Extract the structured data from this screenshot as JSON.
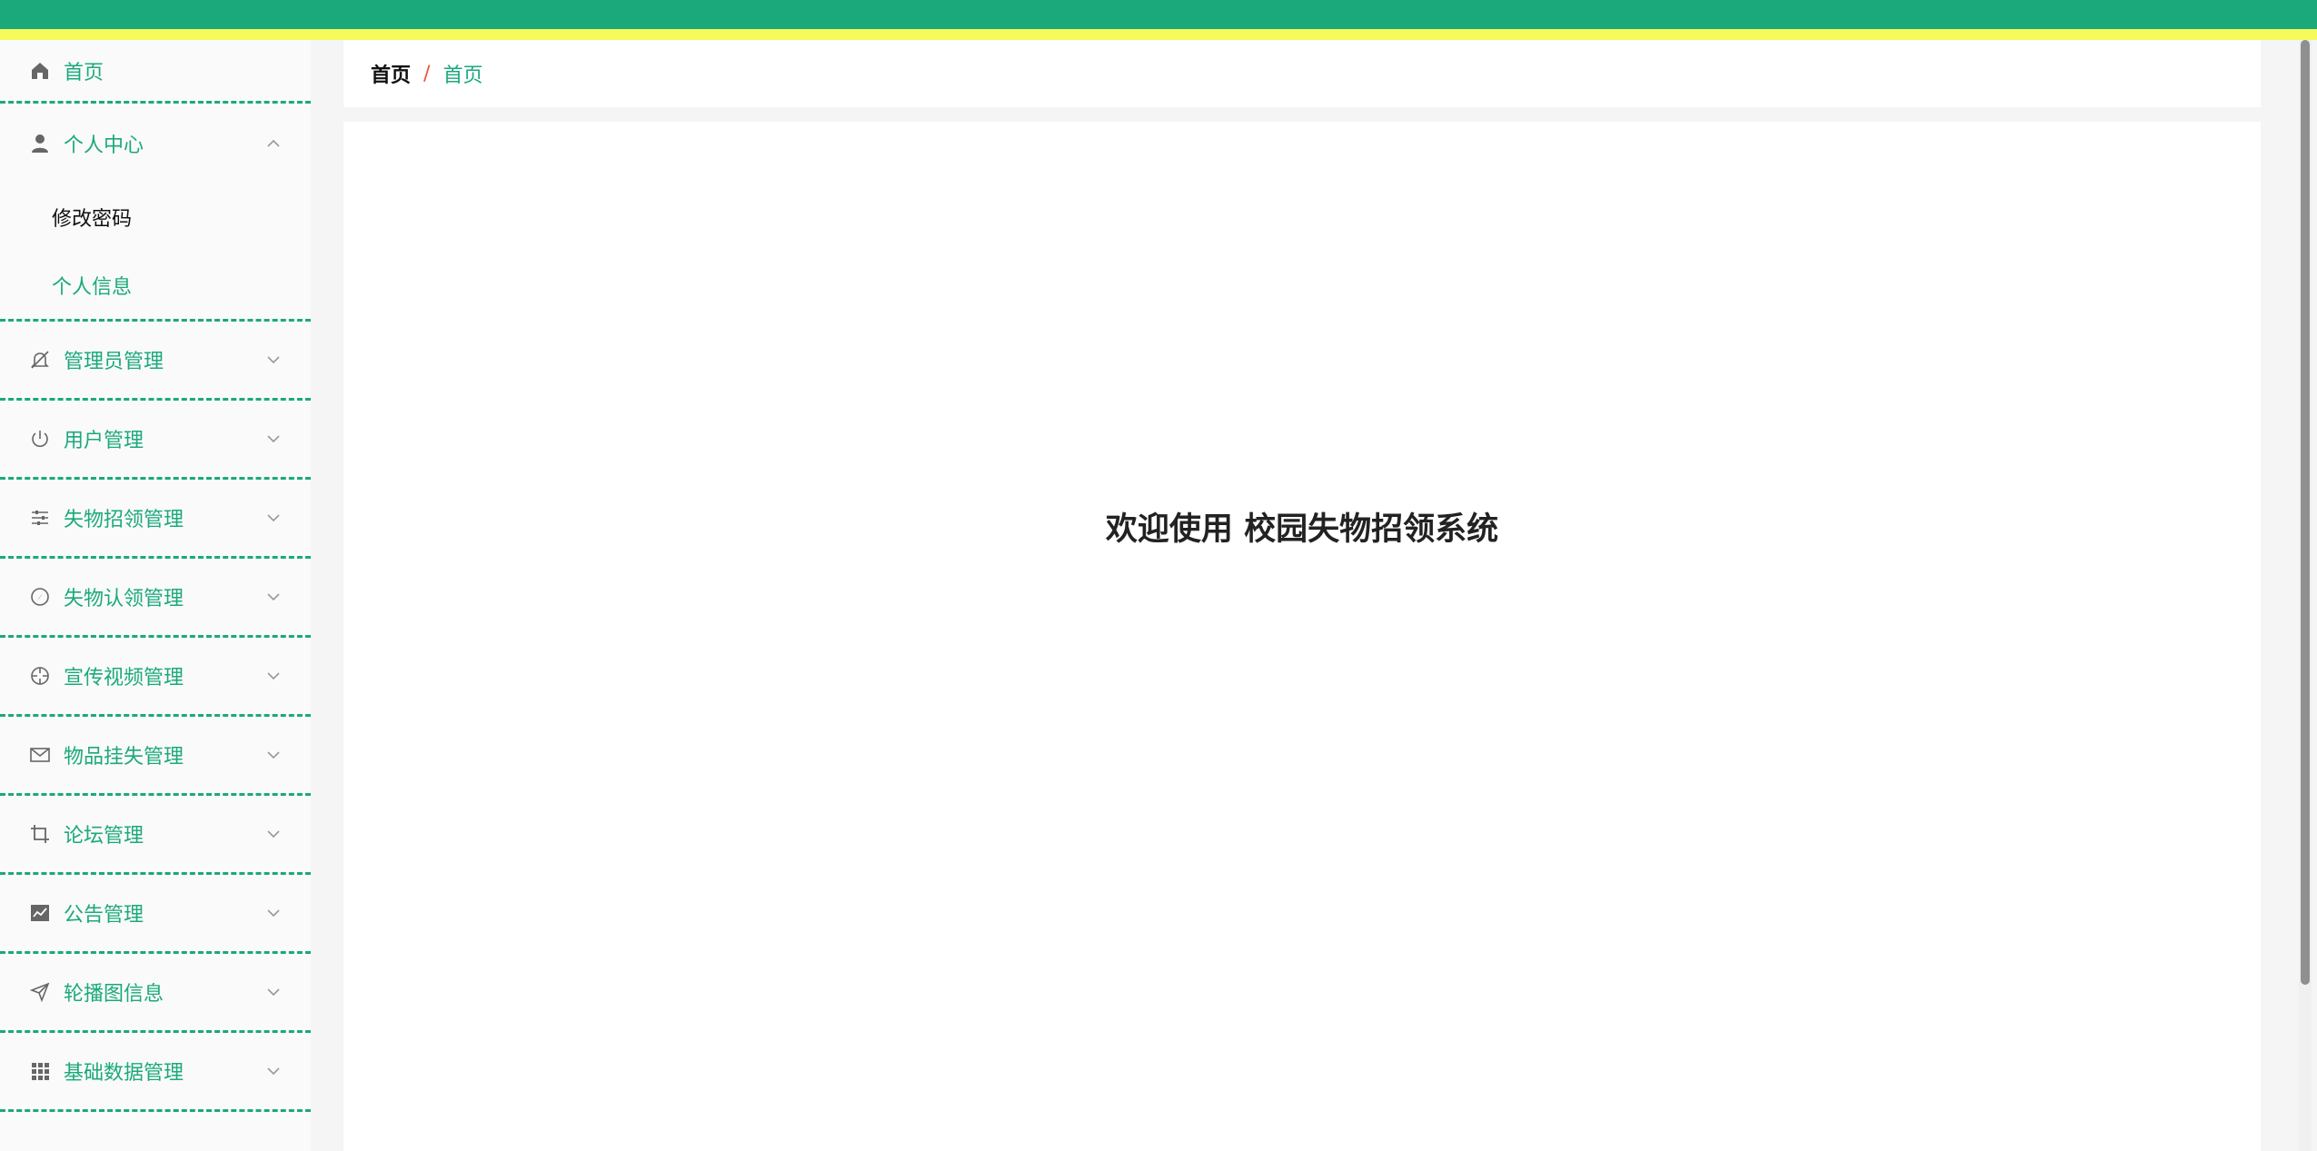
{
  "colors": {
    "accent": "#1ba97c",
    "topbar_stripe": "#f4fb5a",
    "breadcrumb_separator": "#e8553b"
  },
  "sidebar": {
    "items": [
      {
        "label": "首页",
        "icon": "home-icon"
      },
      {
        "label": "个人中心",
        "icon": "user-icon",
        "expanded": true,
        "children": [
          {
            "label": "修改密码",
            "active": true
          },
          {
            "label": "个人信息"
          }
        ]
      },
      {
        "label": "管理员管理",
        "icon": "bell-off-icon"
      },
      {
        "label": "用户管理",
        "icon": "power-icon"
      },
      {
        "label": "失物招领管理",
        "icon": "sliders-icon"
      },
      {
        "label": "失物认领管理",
        "icon": "compass-icon"
      },
      {
        "label": "宣传视频管理",
        "icon": "crosshair-icon"
      },
      {
        "label": "物品挂失管理",
        "icon": "mail-icon"
      },
      {
        "label": "论坛管理",
        "icon": "crop-icon"
      },
      {
        "label": "公告管理",
        "icon": "chart-icon"
      },
      {
        "label": "轮播图信息",
        "icon": "send-icon"
      },
      {
        "label": "基础数据管理",
        "icon": "grid-icon"
      }
    ]
  },
  "breadcrumb": {
    "root": "首页",
    "separator": "/",
    "current": "首页"
  },
  "main": {
    "welcome_text": "欢迎使用 校园失物招领系统"
  }
}
